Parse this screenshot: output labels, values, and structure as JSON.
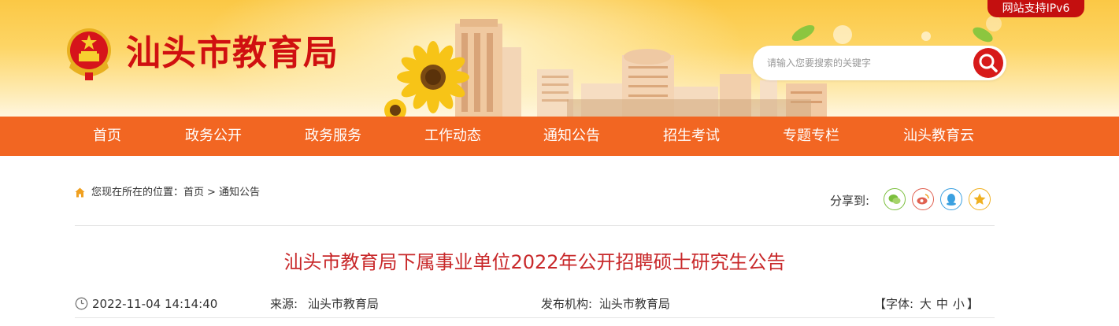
{
  "header": {
    "site_title": "汕头市教育局",
    "ipv6_badge": "网站支持IPv6",
    "search_placeholder": "请输入您要搜索的关键字"
  },
  "nav": {
    "items": [
      "首页",
      "政务公开",
      "政务服务",
      "工作动态",
      "通知公告",
      "招生考试",
      "专题专栏",
      "汕头教育云"
    ]
  },
  "breadcrumb": {
    "prefix": "您现在所在的位置：",
    "items": [
      "首页",
      "通知公告"
    ],
    "separator": ">"
  },
  "share": {
    "label": "分享到:",
    "targets": [
      "wechat-icon",
      "weibo-icon",
      "qq-icon",
      "qzone-icon"
    ],
    "colors": {
      "wechat": "#7bbf3d",
      "weibo": "#e06050",
      "qq": "#3aa0e0",
      "qzone": "#f0b020"
    }
  },
  "article": {
    "title": "汕头市教育局下属事业单位2022年公开招聘硕士研究生公告",
    "datetime": "2022-11-04 14:14:40",
    "source_label": "来源:",
    "source_value": "汕头市教育局",
    "publisher_label": "发布机构:",
    "publisher_value": "汕头市教育局",
    "font_size_open": "【字体:",
    "font_size_options": [
      "大",
      "中",
      "小"
    ],
    "font_size_close": "】"
  },
  "colors": {
    "nav_bg": "#f26622",
    "title_red": "#d01010",
    "article_title": "#c8282a",
    "ipv6_bg": "#c40f0f"
  }
}
